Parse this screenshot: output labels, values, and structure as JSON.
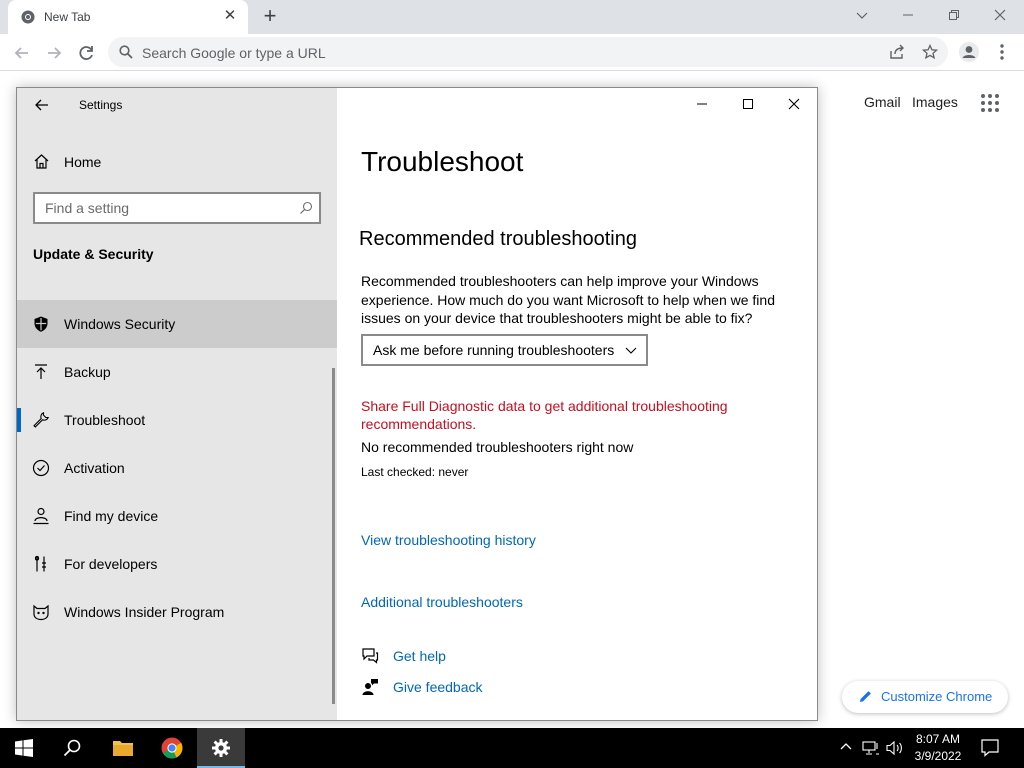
{
  "browser": {
    "tab_title": "New Tab",
    "omnibox_placeholder": "Search Google or type a URL",
    "ntp_links": [
      "Gmail",
      "Images"
    ],
    "customize_label": "Customize Chrome"
  },
  "settings": {
    "app_title": "Settings",
    "home_label": "Home",
    "search_placeholder": "Find a setting",
    "section_title": "Update & Security",
    "nav_items": [
      {
        "label": "Windows Security",
        "icon": "shield-icon"
      },
      {
        "label": "Backup",
        "icon": "backup-arrow-icon"
      },
      {
        "label": "Troubleshoot",
        "icon": "wrench-icon",
        "selected": true
      },
      {
        "label": "Activation",
        "icon": "check-circle-icon"
      },
      {
        "label": "Find my device",
        "icon": "person-location-icon"
      },
      {
        "label": "For developers",
        "icon": "developer-tools-icon"
      },
      {
        "label": "Windows Insider Program",
        "icon": "insider-cat-icon"
      }
    ],
    "page_title": "Troubleshoot",
    "sub_title": "Recommended troubleshooting",
    "description": "Recommended troubleshooters can help improve your Windows experience. How much do you want Microsoft to help when we find issues on your device that troubleshooters might be able to fix?",
    "dropdown_value": "Ask me before running troubleshooters",
    "diagnostic_link": "Share Full Diagnostic data to get additional troubleshooting recommendations.",
    "no_recommended": "No recommended troubleshooters right now",
    "last_checked": "Last checked: never",
    "history_link": "View troubleshooting history",
    "additional_link": "Additional troubleshooters",
    "get_help": "Get help",
    "give_feedback": "Give feedback"
  },
  "taskbar": {
    "time": "8:07 AM",
    "date": "3/9/2022"
  },
  "colors": {
    "accent": "#0067c0",
    "link": "#0067b8",
    "warning_red": "#c50f1f",
    "sidebar_bg": "#e6e6e6",
    "selected_bg": "#cccccc"
  }
}
